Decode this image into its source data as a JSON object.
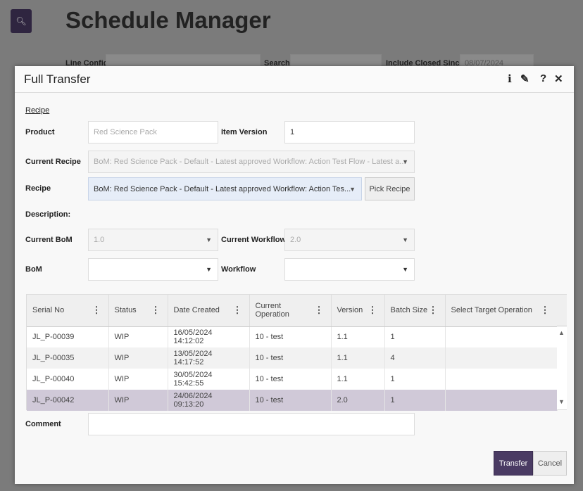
{
  "background": {
    "title": "Schedule Manager",
    "line_config_label": "Line Config",
    "search_label": "Search",
    "include_closed_label": "Include Closed Since",
    "include_closed_value": "08/07/2024"
  },
  "modal": {
    "title": "Full Transfer",
    "icons": [
      "info-icon",
      "pencil-icon",
      "help-icon",
      "close-icon"
    ],
    "section": "Recipe",
    "product_label": "Product",
    "product_placeholder": "Red Science Pack",
    "item_version_label": "Item Version",
    "item_version_value": "1",
    "current_recipe_label": "Current Recipe",
    "current_recipe_value": "BoM: Red Science Pack - Default - Latest approved Workflow: Action Test Flow - Latest a...",
    "recipe_label": "Recipe",
    "recipe_value": "BoM: Red Science Pack - Default - Latest approved Workflow: Action Tes...",
    "pick_recipe": "Pick Recipe",
    "description_label": "Description:",
    "current_bom_label": "Current BoM",
    "current_bom_value": "1.0",
    "current_workflow_label": "Current Workflow",
    "current_workflow_value": "2.0",
    "bom_label": "BoM",
    "bom_value": "",
    "workflow_label": "Workflow",
    "workflow_value": "",
    "table": {
      "columns": [
        "Serial No",
        "Status",
        "Date Created",
        "Current Operation",
        "Version",
        "Batch Size",
        "Select Target Operation"
      ],
      "rows": [
        [
          "JL_P-00039",
          "WIP",
          "16/05/2024 14:12:02",
          "10 - test",
          "1.1",
          "1",
          ""
        ],
        [
          "JL_P-00035",
          "WIP",
          "13/05/2024 14:17:52",
          "10 - test",
          "1.1",
          "4",
          ""
        ],
        [
          "JL_P-00040",
          "WIP",
          "30/05/2024 15:42:55",
          "10 - test",
          "1.1",
          "1",
          ""
        ],
        [
          "JL_P-00042",
          "WIP",
          "24/06/2024 09:13:20",
          "10 - test",
          "2.0",
          "1",
          ""
        ]
      ],
      "selected_row": 3
    },
    "comment_label": "Comment",
    "comment_value": "",
    "transfer": "Transfer",
    "cancel": "Cancel",
    "accent": "#4a3b63"
  }
}
